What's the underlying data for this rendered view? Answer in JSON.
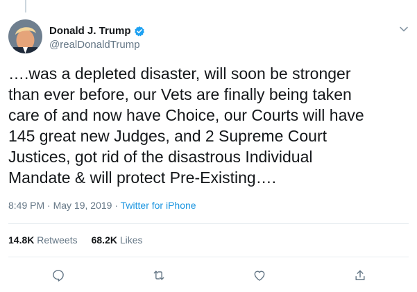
{
  "tweet": {
    "author": {
      "display_name": "Donald J. Trump",
      "handle": "@realDonaldTrump",
      "verified": true,
      "verified_badge_color": "#1da1f2"
    },
    "text": "….was a depleted disaster, will soon be stronger\nthan ever before, our Vets are finally being taken\ncare of and now have Choice, our Courts will have\n145 great new Judges, and 2 Supreme Court\nJustices, got rid of the disastrous Individual\nMandate & will protect Pre-Existing….",
    "time": "8:49 PM",
    "separator": "·",
    "date": "May 19, 2019",
    "source": "Twitter for iPhone",
    "stats": {
      "retweets_count": "14.8K",
      "retweets_label": "Retweets",
      "likes_count": "68.2K",
      "likes_label": "Likes"
    },
    "actions": [
      "reply-icon",
      "retweet-icon",
      "like-icon",
      "share-icon"
    ]
  },
  "colors": {
    "text": "#14171a",
    "secondary": "#657786",
    "link": "#1b95e0",
    "border": "#e6ecf0"
  }
}
